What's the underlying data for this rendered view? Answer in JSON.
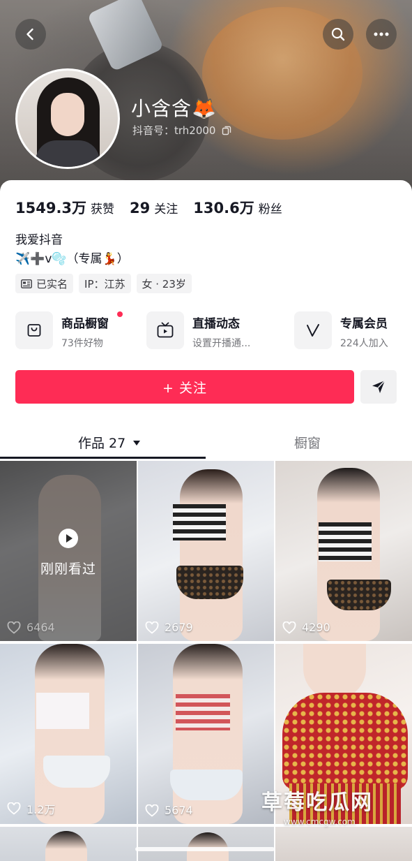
{
  "header": {
    "name": "小含含🦊",
    "douyin_id": "抖音号：trh2000"
  },
  "stats": [
    {
      "value": "1549.3万",
      "label": "获赞"
    },
    {
      "value": "29",
      "label": "关注"
    },
    {
      "value": "130.6万",
      "label": "粉丝"
    }
  ],
  "bio": {
    "line1": "我爱抖音",
    "line2": "✈️➕v🫧（专属💃）"
  },
  "tags": [
    {
      "icon": "id-card-icon",
      "label": "已实名"
    },
    {
      "icon": "",
      "label": "IP：江苏"
    },
    {
      "icon": "",
      "label": "女 · 23岁"
    }
  ],
  "features": [
    {
      "title": "商品橱窗",
      "sub": "73件好物",
      "icon": "shopping-bag-icon"
    },
    {
      "title": "直播动态",
      "sub": "设置开播通...",
      "icon": "tv-icon"
    },
    {
      "title": "专属会员",
      "sub": "224人加入",
      "icon": "v-badge-icon"
    }
  ],
  "actions": {
    "follow_label": "+ 关注"
  },
  "tabs": {
    "works": "作品 27",
    "showcase": "橱窗"
  },
  "videos": [
    {
      "likes": "6464",
      "watched": "刚刚看过"
    },
    {
      "likes": "2679"
    },
    {
      "likes": "4290"
    },
    {
      "likes": "1.2万"
    },
    {
      "likes": "5674"
    },
    {
      "likes": ""
    }
  ],
  "watermark": {
    "title": "草莓吃瓜网",
    "url": "www.cmcgw.com"
  },
  "colors": {
    "accent": "#fe2c55",
    "text": "#161823",
    "subtext": "#75767b"
  }
}
